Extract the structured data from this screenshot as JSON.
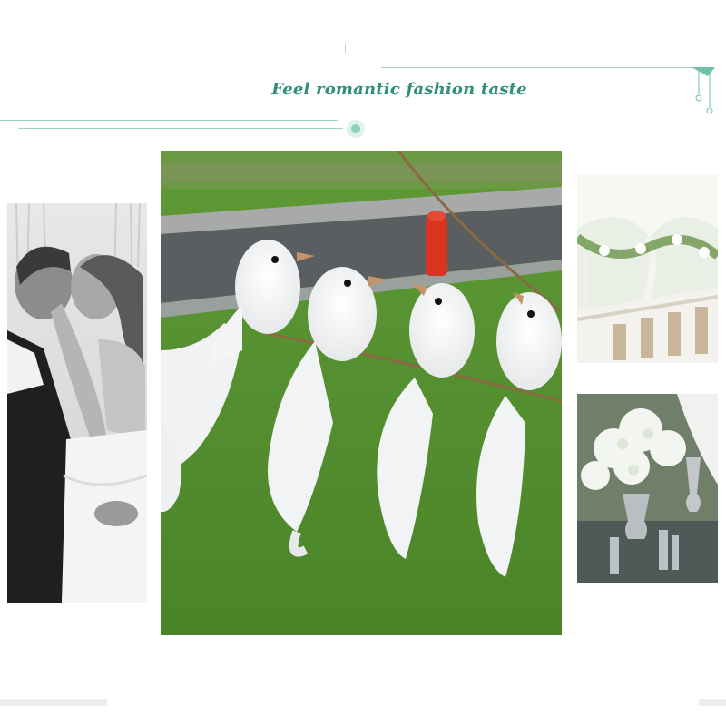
{
  "header": {
    "tagline": "Feel romantic fashion taste"
  },
  "colors": {
    "accent": "#2f8f78",
    "accent_light": "#bfe3d8",
    "grass": "#4f8a2c",
    "road": "#5b5e60",
    "bg": "#ffffff"
  },
  "images": {
    "left": "wedding-couple-kiss-photo",
    "center": "white-feather-doves-on-branch-photo",
    "right_top": "wedding-reception-table-photo",
    "right_bottom": "white-flower-centerpiece-photo"
  }
}
